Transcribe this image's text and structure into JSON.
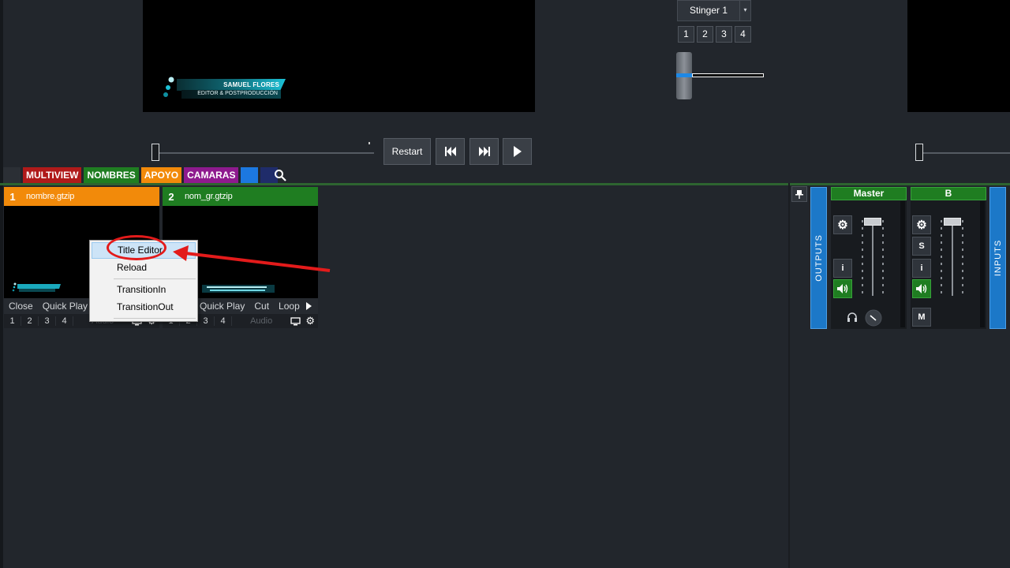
{
  "preview": {
    "lower_third_name": "SAMUEL FLORES",
    "lower_third_role": "EDITOR & POSTPRODUCCIÓN"
  },
  "transition": {
    "stinger_label": "Stinger 1",
    "numbers": [
      "1",
      "2",
      "3",
      "4"
    ],
    "colors": {
      "tbar_accent": "#1e88e5"
    }
  },
  "transport": {
    "restart_label": "Restart",
    "icons": [
      "skip-back-icon",
      "skip-forward-icon",
      "play-icon"
    ]
  },
  "tabs": [
    {
      "label": "",
      "color": "#2b2f35"
    },
    {
      "label": "MULTIVIEW",
      "color": "#b01a1a"
    },
    {
      "label": "NOMBRES",
      "color": "#1f7d21"
    },
    {
      "label": "APOYO",
      "color": "#f28a0a"
    },
    {
      "label": "CAMARAS",
      "color": "#8e1a8e"
    },
    {
      "label": "",
      "color": "#1c78e0"
    },
    {
      "label": "",
      "color": "#1f2c6a"
    }
  ],
  "inputs": [
    {
      "number": "1",
      "name": "nombre.gtzip",
      "color": "#f28a0a",
      "actions": [
        "Close",
        "Quick Play"
      ],
      "overlays": [
        "1",
        "2",
        "3",
        "4"
      ],
      "audio": "Audio"
    },
    {
      "number": "2",
      "name": "nom_gr.gtzip",
      "color": "#1f7d21",
      "actions": [
        "Quick Play",
        "Cut",
        "Loop"
      ],
      "overlays": [
        "1",
        "2",
        "3",
        "4"
      ],
      "audio": "Audio"
    }
  ],
  "context_menu": {
    "items": [
      "Title Editor",
      "Reload",
      "TransitionIn",
      "TransitionOut"
    ],
    "highlighted": "Title Editor"
  },
  "mixer": {
    "outputs_label": "OUTPUTS",
    "inputs_label": "INPUTS",
    "strips": [
      {
        "name": "Master",
        "buttons": [
          "i"
        ],
        "fader_level": 1.0
      },
      {
        "name": "B",
        "buttons": [
          "S",
          "i",
          "M"
        ],
        "fader_level": 1.0
      }
    ]
  },
  "annotation": {
    "color": "#e31b1b"
  }
}
